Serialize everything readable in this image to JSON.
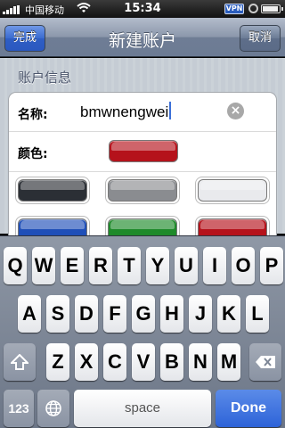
{
  "status_bar": {
    "carrier": "中国移动",
    "time": "15:34",
    "vpn_label": "VPN",
    "battery_level": 0.95
  },
  "nav": {
    "title": "新建账户",
    "left_button": "完成",
    "right_button": "取消"
  },
  "section": {
    "header": "账户信息",
    "name_label": "名称:",
    "name_value": "bmwnengwei",
    "color_label": "颜色:",
    "selected_color": "#b5121b",
    "colors": [
      {
        "name": "black",
        "hex": "#2b2f35"
      },
      {
        "name": "gray",
        "hex": "#8a8c90"
      },
      {
        "name": "white",
        "hex": "#e9eaed"
      },
      {
        "name": "blue",
        "hex": "#1f4fb8"
      },
      {
        "name": "green",
        "hex": "#1e8a2a"
      },
      {
        "name": "red",
        "hex": "#b5121b"
      }
    ]
  },
  "keyboard": {
    "row1": [
      "Q",
      "W",
      "E",
      "R",
      "T",
      "Y",
      "U",
      "I",
      "O",
      "P"
    ],
    "row2": [
      "A",
      "S",
      "D",
      "F",
      "G",
      "H",
      "J",
      "K",
      "L"
    ],
    "row3": [
      "Z",
      "X",
      "C",
      "V",
      "B",
      "N",
      "M"
    ],
    "numbers_key": "123",
    "space_key": "space",
    "done_key": "Done",
    "shift_icon": "shift-arrow-icon",
    "delete_icon": "backspace-icon",
    "globe_icon": "globe-icon"
  }
}
